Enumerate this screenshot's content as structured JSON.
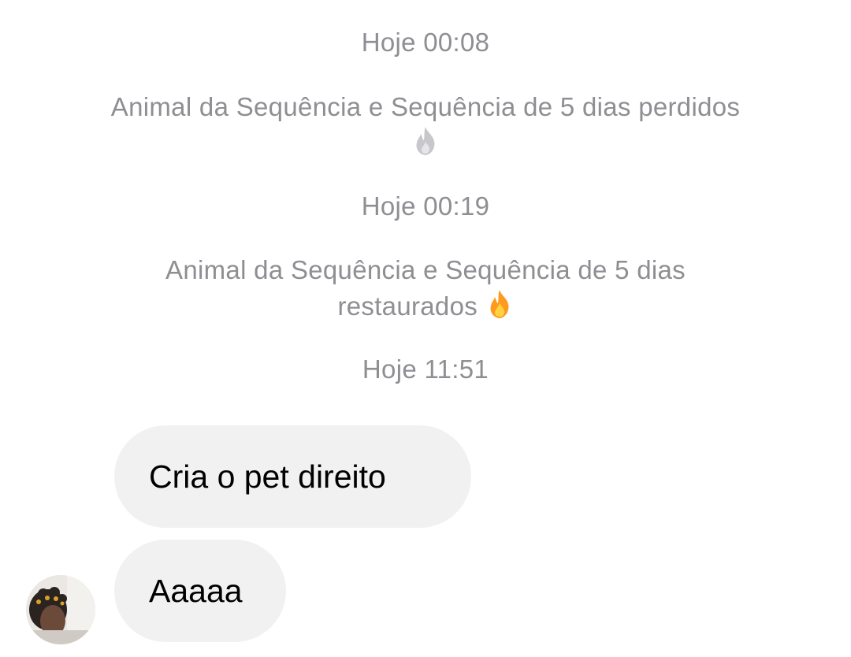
{
  "messages": {
    "timestamp_1": "Hoje 00:08",
    "system_1": "Animal da Sequência e Sequência de 5 dias perdidos",
    "system_1_icon": "flame-icon-gray",
    "timestamp_2": "Hoje 00:19",
    "system_2_line1": "Animal da Sequência e Sequência de 5 dias",
    "system_2_line2": "restaurados",
    "system_2_icon": "flame-icon",
    "timestamp_3": "Hoje 11:51",
    "bubble_1": "Cria o pet direito",
    "bubble_2": "Aaaaa"
  },
  "colors": {
    "meta_text": "#8e8e93",
    "bubble_bg": "#f1f1f1",
    "flame_orange": "#ff9a1f",
    "flame_gray": "#c7c7cc"
  }
}
